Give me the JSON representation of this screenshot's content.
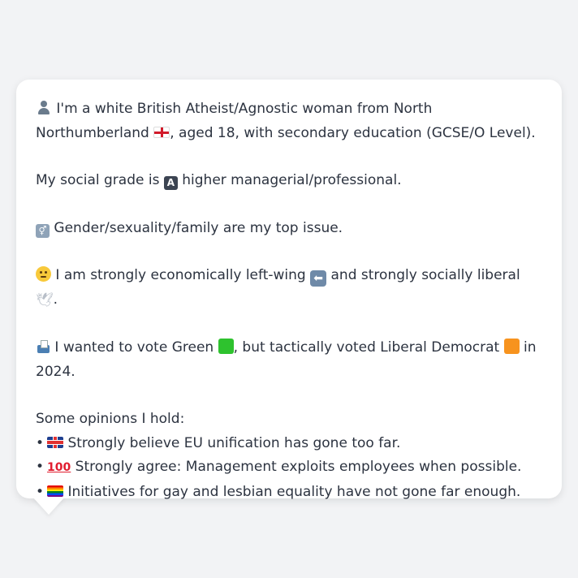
{
  "message": {
    "intro": {
      "icon": "bust-in-silhouette-icon",
      "text_a": "I'm a white British Atheist/Agnostic woman from North Northumberland",
      "flag": "england-flag-icon",
      "text_b": ", aged 18, with secondary education (GCSE/O Level)."
    },
    "social_grade": {
      "text_a": "My social grade is",
      "grade_letter": "A",
      "text_b": "higher managerial/professional."
    },
    "top_issue": {
      "icon": "restroom-icon",
      "text": "Gender/sexuality/family are my top issue."
    },
    "ideology": {
      "icon": "thinking-face-icon",
      "text_a": "I am strongly economically left-wing",
      "arrow_icon": "left-arrow-icon",
      "text_b": "and strongly socially liberal",
      "dove_icon": "dove-icon",
      "text_c": "."
    },
    "vote": {
      "icon": "ballot-box-icon",
      "text_a": "I wanted to vote Green",
      "green_color": "#2ec22e",
      "text_b": ", but tactically voted Liberal Democrat",
      "orange_color": "#f7931e",
      "text_c": "in 2024."
    },
    "opinions": {
      "heading": "Some opinions I hold:",
      "items": [
        {
          "bullet": "•",
          "icon": "uk-flag-icon",
          "text": "Strongly believe EU unification has gone too far."
        },
        {
          "bullet": "•",
          "icon": "hundred-points-icon",
          "text": "Strongly agree: Management exploits employees when possible."
        },
        {
          "bullet": "•",
          "icon": "rainbow-flag-icon",
          "text": "Initiatives for gay and lesbian equality have not gone far enough."
        }
      ]
    }
  }
}
